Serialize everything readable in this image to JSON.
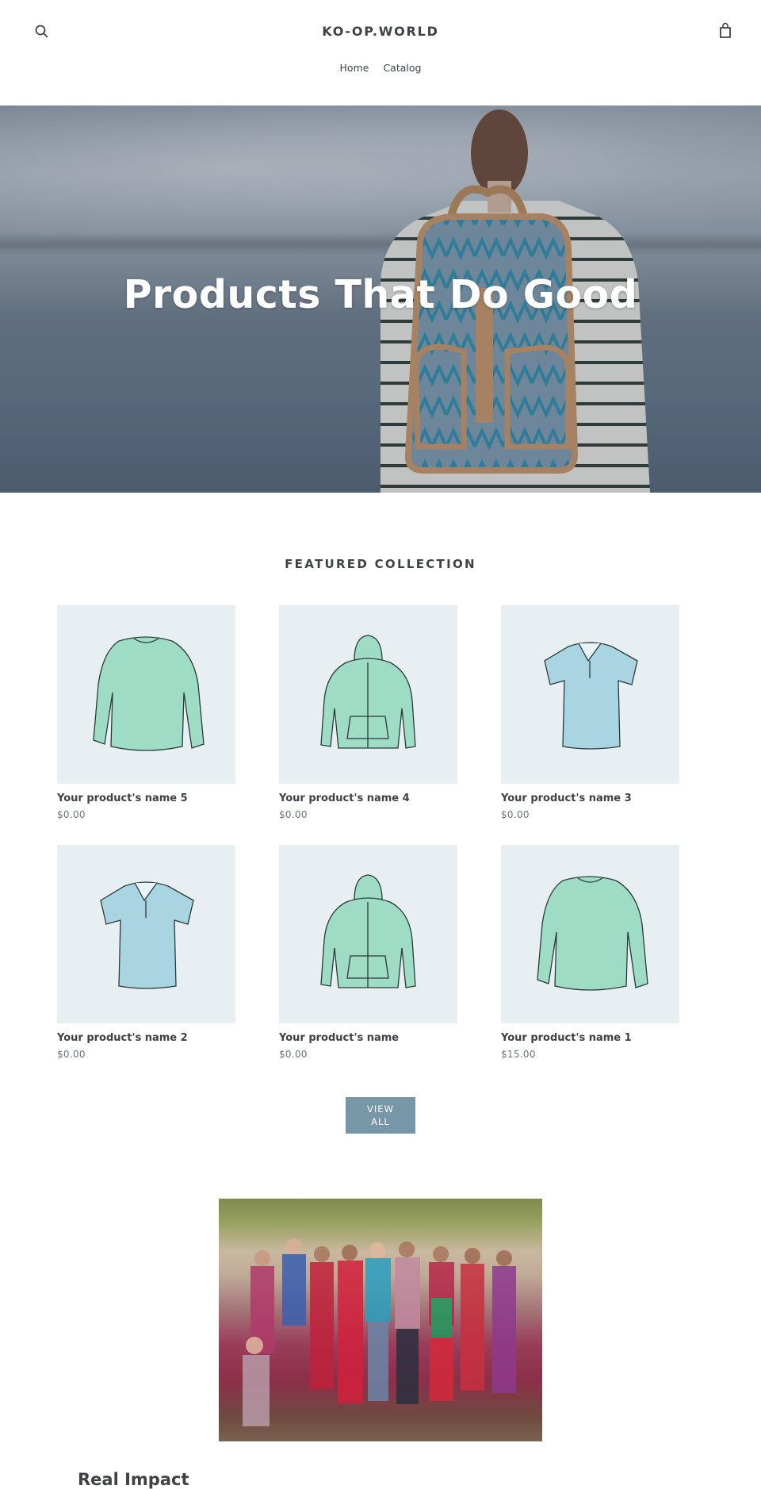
{
  "header": {
    "logo": "KO-OP.WORLD",
    "search_icon": "search-icon",
    "cart_icon": "shopping-bag-icon",
    "nav": [
      {
        "label": "Home"
      },
      {
        "label": "Catalog"
      }
    ]
  },
  "hero": {
    "title": "Products That Do Good"
  },
  "featured": {
    "title": "FEATURED COLLECTION",
    "products": [
      {
        "name": "Your product's name 5",
        "price": "$0.00",
        "image": "long-sleeve-shirt",
        "color": "#9fdcc6"
      },
      {
        "name": "Your product's name 4",
        "price": "$0.00",
        "image": "hoodie",
        "color": "#9fdcc6"
      },
      {
        "name": "Your product's name 3",
        "price": "$0.00",
        "image": "polo-shirt",
        "color": "#a9d4e2"
      },
      {
        "name": "Your product's name 2",
        "price": "$0.00",
        "image": "polo-shirt",
        "color": "#a9d4e2"
      },
      {
        "name": "Your product's name",
        "price": "$0.00",
        "image": "hoodie",
        "color": "#9fdcc6"
      },
      {
        "name": "Your product's name 1",
        "price": "$15.00",
        "image": "long-sleeve-shirt",
        "color": "#9fdcc6"
      }
    ],
    "view_all_line1": "VIEW",
    "view_all_line2": "ALL"
  },
  "impact": {
    "title": "Real Impact",
    "image": "group-photo"
  },
  "colors": {
    "text": "#3d4246",
    "price": "#69727b",
    "button": "#7796a8",
    "card_bg": "#e8eff2"
  }
}
